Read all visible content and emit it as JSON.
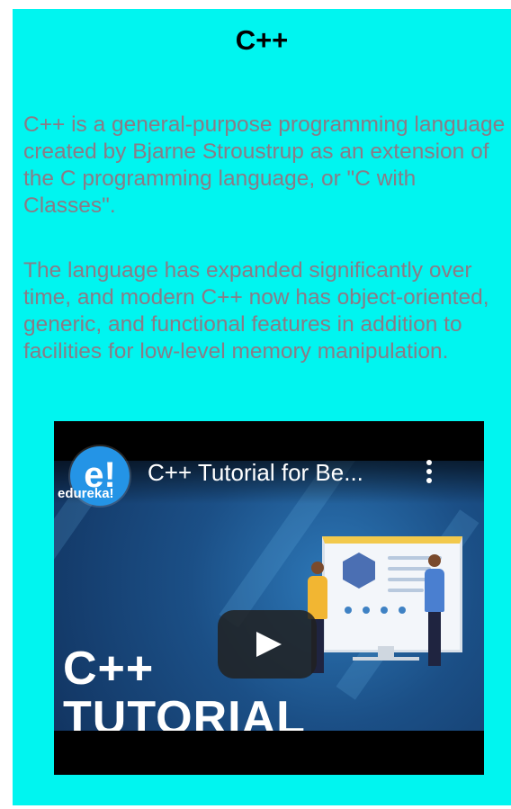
{
  "article": {
    "title": "C++",
    "paragraphs": [
      "C++ is a general-purpose programming language created by Bjarne Stroustrup as an extension of the C programming language, or \"C with Classes\".",
      "The language has expanded significantly over time, and modern C++ now has object-oriented, generic, and functional features in addition to facilities for low-level memory manipulation."
    ]
  },
  "video": {
    "title": "C++ Tutorial for Be...",
    "channel_logo_text": "e!",
    "channel_name": "edureka!",
    "thumbnail_line1": "C++",
    "thumbnail_line2": "TUTORIAL",
    "icons": {
      "more": "more-vertical-icon",
      "play": "play-icon"
    }
  },
  "colors": {
    "background": "#00f5f0",
    "paragraph_text": "#8a7b86",
    "title_text": "#000000",
    "channel_logo": "#2494e6"
  }
}
